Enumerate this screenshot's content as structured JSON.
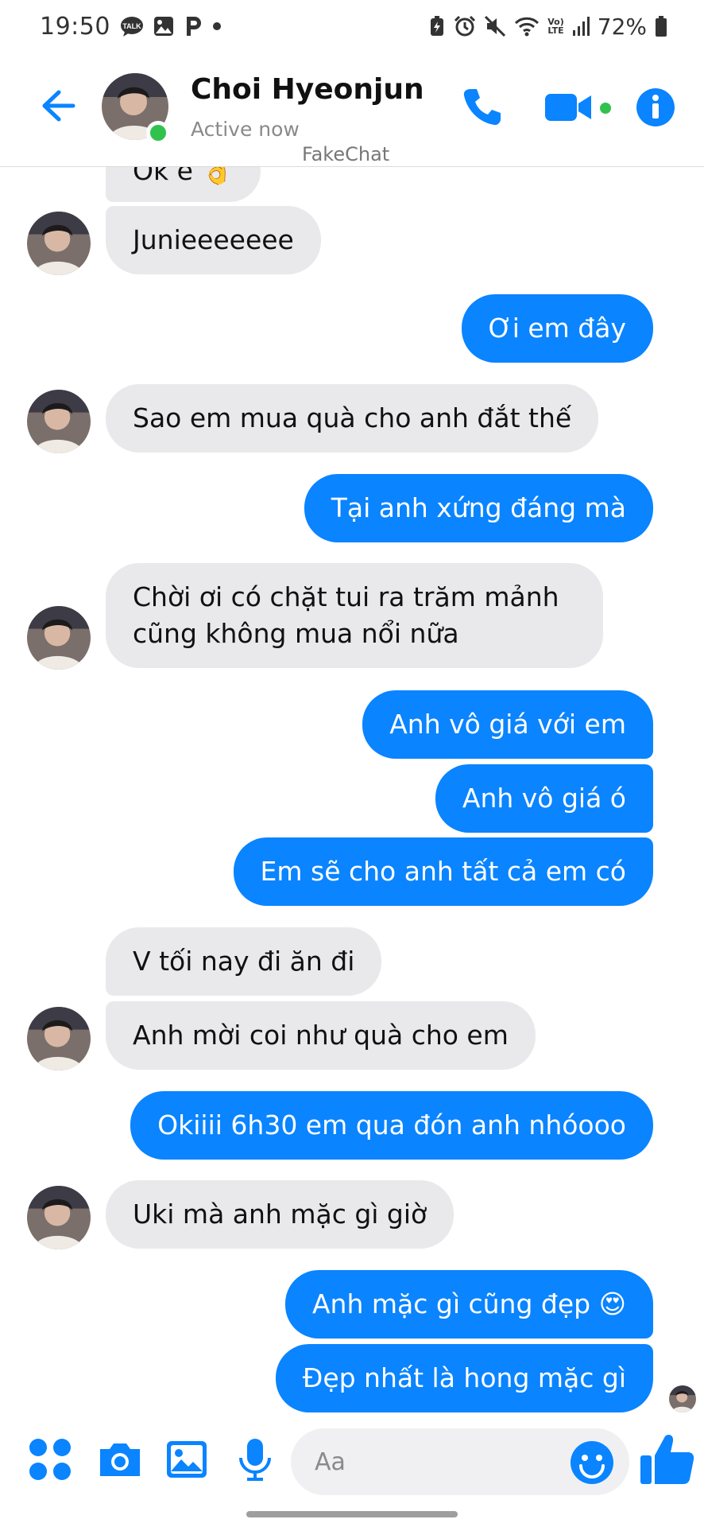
{
  "status_bar": {
    "time": "19:50",
    "talk_badge": "TALK",
    "lte_top": "Vo)",
    "lte_bottom": "LTE",
    "battery": "72%"
  },
  "header": {
    "name": "Choi Hyeonjun",
    "status": "Active now",
    "watermark": "FakeChat"
  },
  "messages": [
    {
      "dir": "in",
      "text": "Ok e 👌"
    },
    {
      "dir": "in",
      "text": "Junieeeeeee"
    },
    {
      "dir": "out",
      "text": "Ơi em đây"
    },
    {
      "dir": "in",
      "text": "Sao em mua quà cho anh đắt thế"
    },
    {
      "dir": "out",
      "text": "Tại anh xứng đáng mà"
    },
    {
      "dir": "in",
      "text": "Chời ơi có chặt tui ra trăm mảnh\ncũng không mua nổi nữa"
    },
    {
      "dir": "out",
      "text": "Anh vô giá với em"
    },
    {
      "dir": "out",
      "text": "Anh vô giá ó"
    },
    {
      "dir": "out",
      "text": "Em sẽ cho anh tất cả em có"
    },
    {
      "dir": "in",
      "text": "V tối nay đi ăn đi"
    },
    {
      "dir": "in",
      "text": "Anh mời coi như quà cho em"
    },
    {
      "dir": "out",
      "text": "Okiiii 6h30 em qua đón anh nhóooo"
    },
    {
      "dir": "in",
      "text": "Uki mà anh mặc gì giờ"
    },
    {
      "dir": "out",
      "text": "Anh mặc gì cũng đẹp 😍"
    },
    {
      "dir": "out",
      "text": "Đẹp nhất là hong mặc gì"
    }
  ],
  "composer": {
    "placeholder": "Aa"
  },
  "icons": [
    "talk-icon",
    "gallery-icon",
    "bolt-icon",
    "battery-saver-icon",
    "alarm-icon",
    "mute-icon",
    "wifi-icon",
    "signal-icon",
    "battery-icon",
    "back-arrow-icon",
    "phone-icon",
    "video-camera-icon",
    "info-icon",
    "apps-icon",
    "camera-icon",
    "image-icon",
    "microphone-icon",
    "emoji-icon",
    "thumbs-up-icon"
  ],
  "colors": {
    "accent": "#0a84ff",
    "incoming_bubble": "#e9e9eb",
    "active_green": "#31c24d"
  }
}
